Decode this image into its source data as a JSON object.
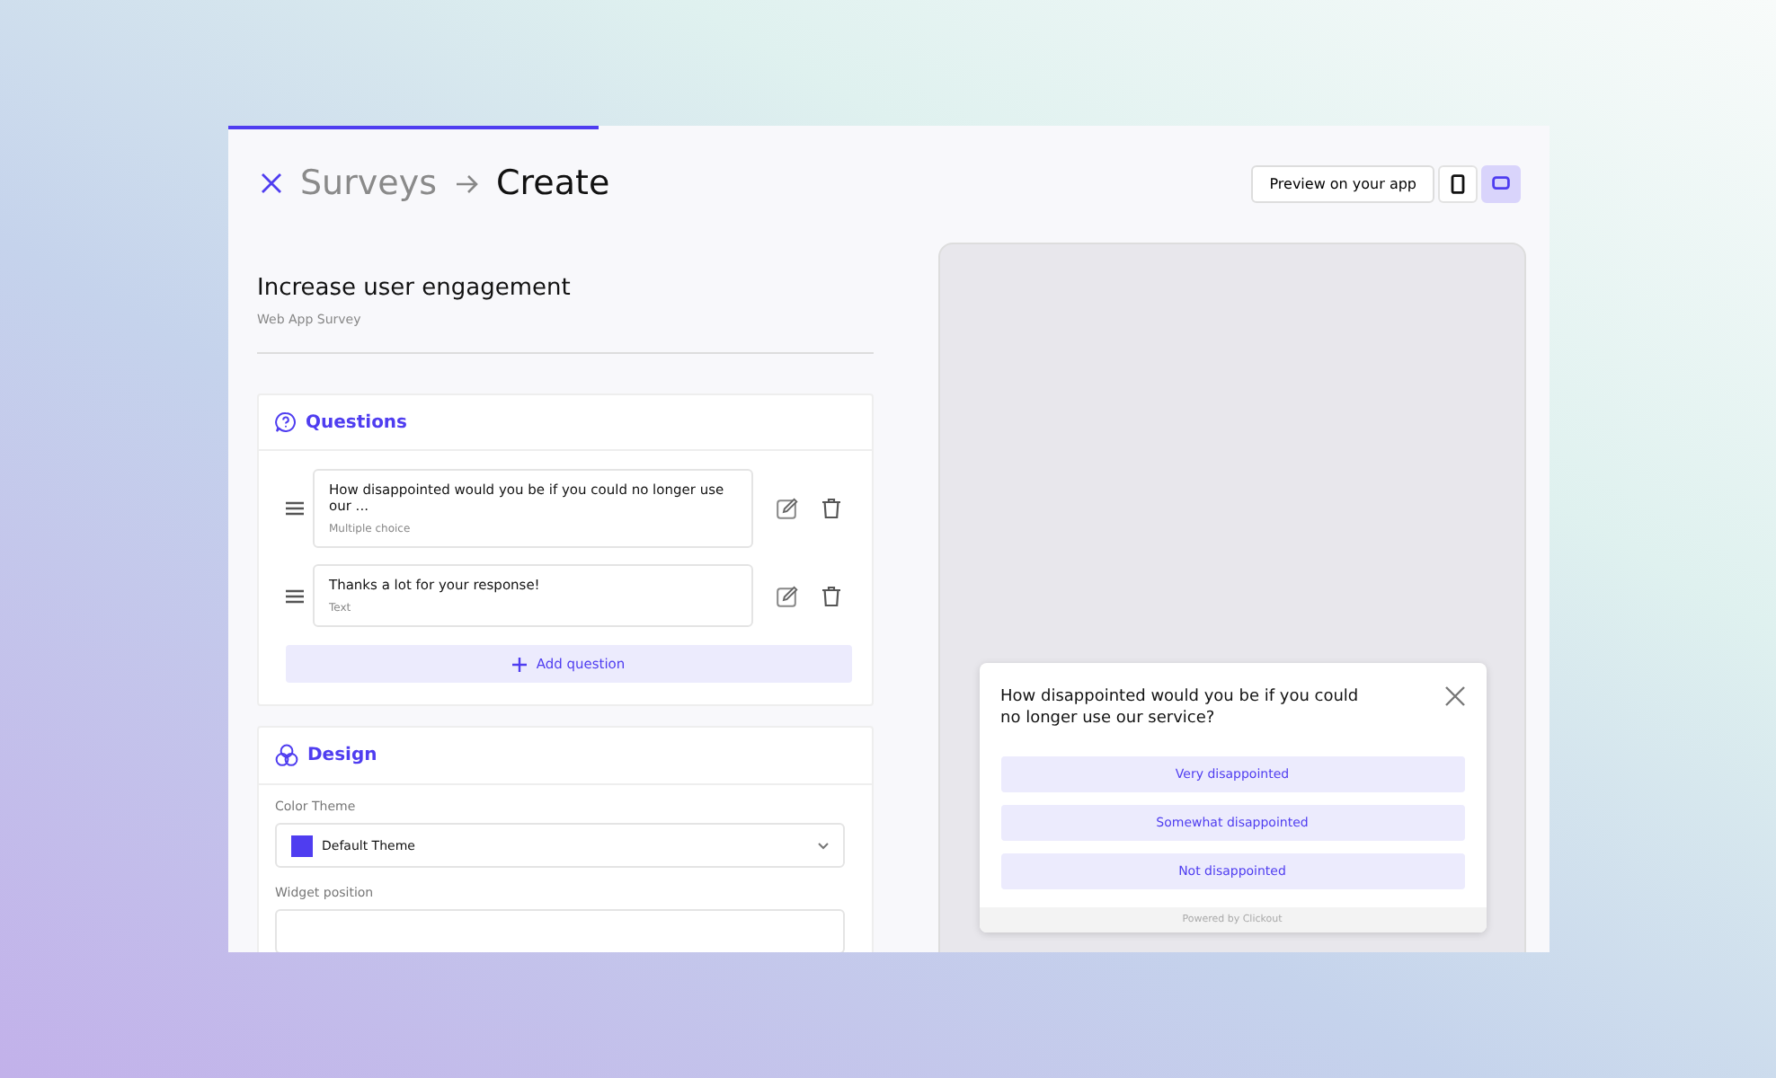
{
  "progress": {
    "level": 0.28
  },
  "breadcrumb": {
    "parent": "Surveys",
    "current": "Create"
  },
  "preview_button": "Preview on your app",
  "devices": [
    {
      "kind": "mobile",
      "selected": false
    },
    {
      "kind": "desktop",
      "selected": true
    }
  ],
  "survey": {
    "title": "Increase user engagement",
    "subtitle": "Web App Survey"
  },
  "questions": {
    "title": "Questions",
    "items": [
      {
        "text": "How disappointed would you be if you could no longer use our ...",
        "type": "Multiple choice"
      },
      {
        "text": "Thanks a lot for your response!",
        "type": "Text"
      }
    ],
    "add_button": "Add question"
  },
  "design": {
    "title": "Design",
    "color_theme_label": "Color Theme",
    "color_theme": {
      "name": "Default Theme",
      "color": "#4f3df0"
    },
    "widget_position_label": "Widget position"
  },
  "widget": {
    "question": "How disappointed would you be if you could no longer use our service?",
    "options": [
      "Very disappointed",
      "Somewhat disappointed",
      "Not disappointed"
    ],
    "footer": "Powered by Clickout"
  }
}
